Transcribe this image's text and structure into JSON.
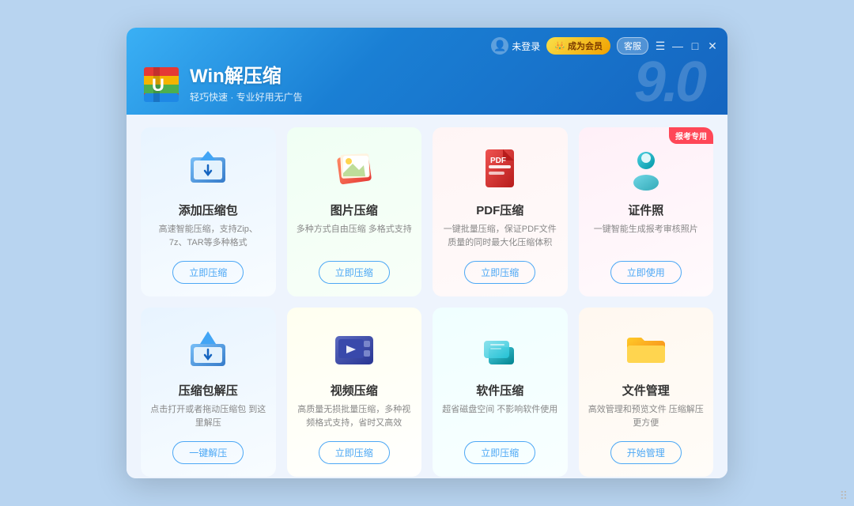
{
  "window": {
    "title": "Win解压缩",
    "subtitle": "轻巧快速 · 专业好用无广告",
    "version": "9.0",
    "user": {
      "login_text": "未登录",
      "vip_button": "成为会员",
      "guest_button": "客服"
    },
    "controls": {
      "menu": "☰",
      "minimize": "—",
      "maximize": "□",
      "close": "✕"
    }
  },
  "cards": [
    {
      "id": "compress",
      "title": "添加压缩包",
      "desc": "高速智能压缩，支持Zip、7z、TAR等多种格式",
      "btn": "立即压缩",
      "tint": "blue-tint",
      "badge": ""
    },
    {
      "id": "image",
      "title": "图片压缩",
      "desc": "多种方式自由压缩 多格式支持",
      "btn": "立即压缩",
      "tint": "green-tint",
      "badge": ""
    },
    {
      "id": "pdf",
      "title": "PDF压缩",
      "desc": "一键批量压缩，保证PDF文件质量的同时最大化压缩体积",
      "btn": "立即压缩",
      "tint": "red-tint",
      "badge": ""
    },
    {
      "id": "idphoto",
      "title": "证件照",
      "desc": "一键智能生成报考审核照片",
      "btn": "立即使用",
      "tint": "pink-tint",
      "badge": "报考专用"
    },
    {
      "id": "decompress",
      "title": "压缩包解压",
      "desc": "点击打开或者拖动压缩包 到这里解压",
      "btn": "一键解压",
      "tint": "blue-tint",
      "badge": ""
    },
    {
      "id": "video",
      "title": "视频压缩",
      "desc": "高质量无损批量压缩，多种视频格式支持，省时又高效",
      "btn": "立即压缩",
      "tint": "yellow-tint",
      "badge": ""
    },
    {
      "id": "software",
      "title": "软件压缩",
      "desc": "超省磁盘空间 不影响软件使用",
      "btn": "立即压缩",
      "tint": "cyan-tint",
      "badge": ""
    },
    {
      "id": "folder",
      "title": "文件管理",
      "desc": "高效管理和预览文件 压缩解压更方便",
      "btn": "开始管理",
      "tint": "orange-tint",
      "badge": ""
    }
  ]
}
